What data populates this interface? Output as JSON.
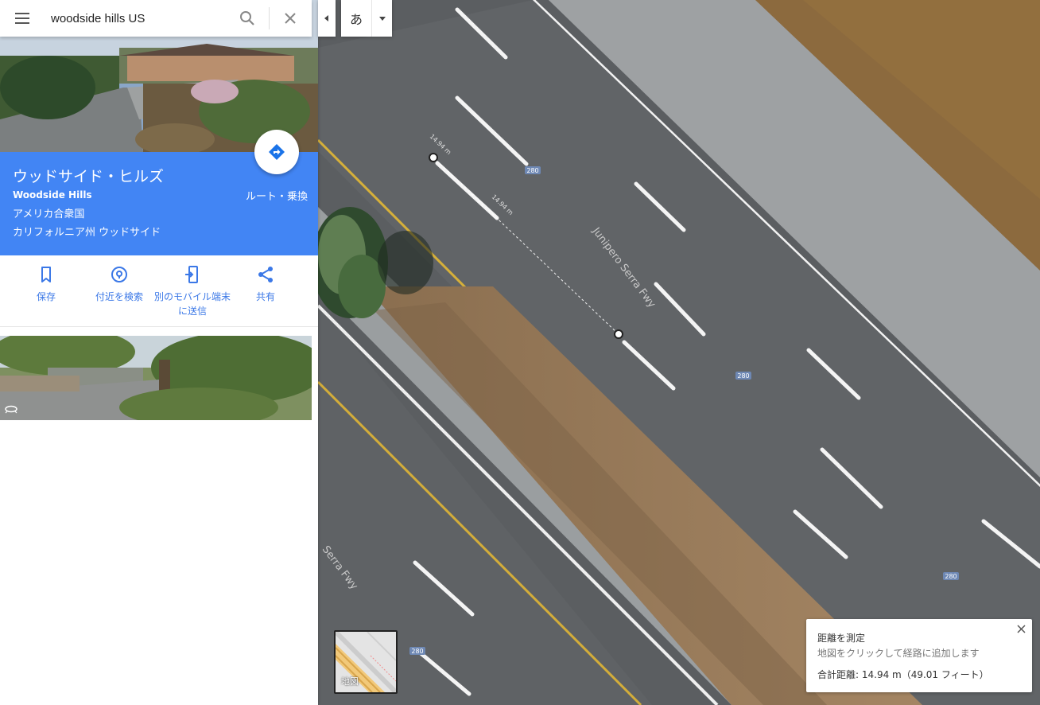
{
  "search": {
    "value": "woodside hills US",
    "menu_icon": "menu-icon",
    "search_icon": "search-icon",
    "clear_icon": "close-icon"
  },
  "ime": {
    "char": "あ"
  },
  "place": {
    "title": "ウッドサイド・ヒルズ",
    "subtitle": "Woodside Hills",
    "addr1": "アメリカ合衆国",
    "addr2": "カリフォルニア州 ウッドサイド",
    "route_label": "ルート・乗換"
  },
  "actions": [
    {
      "label": "保存",
      "icon": "bookmark-icon"
    },
    {
      "label": "付近を検索",
      "icon": "nearby-icon"
    },
    {
      "label": "別のモバイル端末に送信",
      "icon": "send-to-phone-icon"
    },
    {
      "label": "共有",
      "icon": "share-icon"
    }
  ],
  "map": {
    "road_name_1": "Junipero Serra Fwy",
    "road_name_2": "Serra Fwy",
    "shield": "280",
    "measure_label_1": "14.94 m",
    "measure_label_2": "14.94 m",
    "minimap_label": "地図"
  },
  "measure": {
    "title": "距離を測定",
    "hint": "地図をクリックして経路に追加します",
    "total": "合計距離: 14.94 m（49.01 フィート）"
  },
  "colors": {
    "accent": "#4285f4",
    "link": "#3b78e7"
  }
}
